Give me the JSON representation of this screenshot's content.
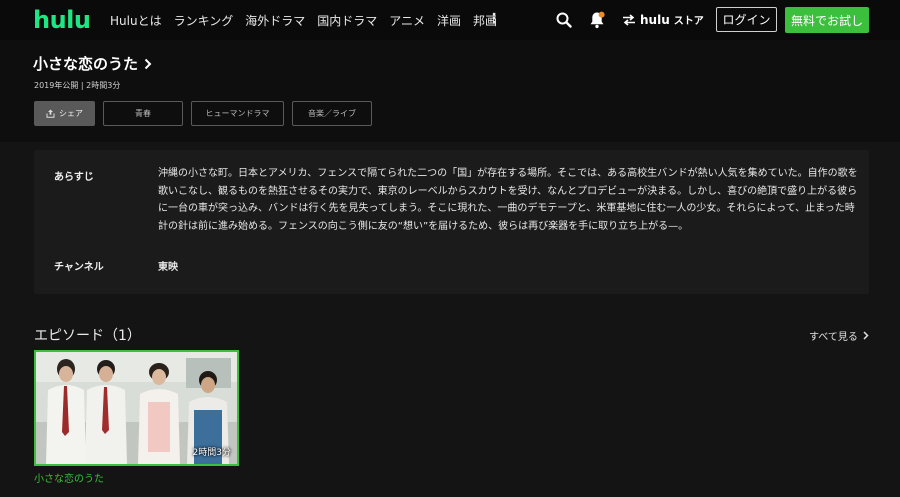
{
  "header": {
    "logo": "hulu",
    "nav": [
      "Huluとは",
      "ランキング",
      "海外ドラマ",
      "国内ドラマ",
      "アニメ",
      "洋画",
      "邦画"
    ],
    "more_icon": "more-vertical-icon",
    "search_icon": "search-icon",
    "bell_icon": "bell-icon",
    "store_brand": "hulu",
    "store_suffix": "ストア",
    "login": "ログイン",
    "trial": "無料でお試し",
    "accent": "#1ce783",
    "trial_color": "#3cbf3c"
  },
  "title": {
    "name": "小さな恋のうた",
    "meta": "2019年公開 | 2時間3分",
    "share": "シェア",
    "tags": [
      "青春",
      "ヒューマンドラマ",
      "音楽／ライブ"
    ]
  },
  "info": {
    "synopsis_label": "あらすじ",
    "synopsis": "沖縄の小さな町。日本とアメリカ、フェンスで隔てられた二つの「国」が存在する場所。そこでは、ある高校生バンドが熱い人気を集めていた。自作の歌を歌いこなし、観るものを熱狂させるその実力で、東京のレーベルからスカウトを受け、なんとプロデビューが決まる。しかし、喜びの絶頂で盛り上がる彼らに一台の車が突っ込み、バンドは行く先を見失ってしまう。そこに現れた、一曲のデモテープと、米軍基地に住む一人の少女。それらによって、止まった時計の針は前に進み始める。フェンスの向こう側に友の“想い”を届けるため、彼らは再び楽器を手に取り立ち上がる—。",
    "channel_label": "チャンネル",
    "channel": "東映"
  },
  "episodes": {
    "heading": "エピソード（1）",
    "see_all": "すべて見る",
    "items": [
      {
        "title": "小さな恋のうた",
        "duration": "2時間3分"
      }
    ]
  }
}
